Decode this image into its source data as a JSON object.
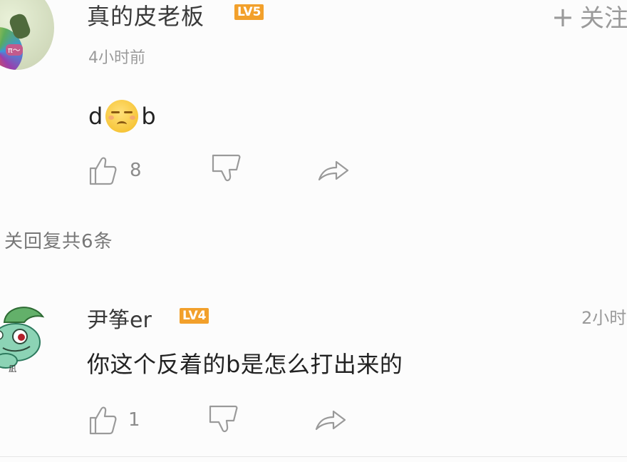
{
  "comment1": {
    "username": "真的皮老板",
    "level": "LV5",
    "follow_label": "关注",
    "time": "4小时前",
    "content_before": "d",
    "content_after": "b",
    "emoji": "smug-face-emoji",
    "likes": "8"
  },
  "replies_label": "关回复共6条",
  "comment2": {
    "username": "尹筝er",
    "level": "LV4",
    "time": "2小时",
    "content": "你这个反着的b是怎么打出来的",
    "likes": "1"
  },
  "colors": {
    "level_badge": "#f2a02b",
    "icon_gray": "#9a9a9a",
    "text_main": "#222222"
  },
  "icons": [
    "thumbs-up-icon",
    "thumbs-down-icon",
    "share-arrow-icon",
    "plus-icon"
  ]
}
